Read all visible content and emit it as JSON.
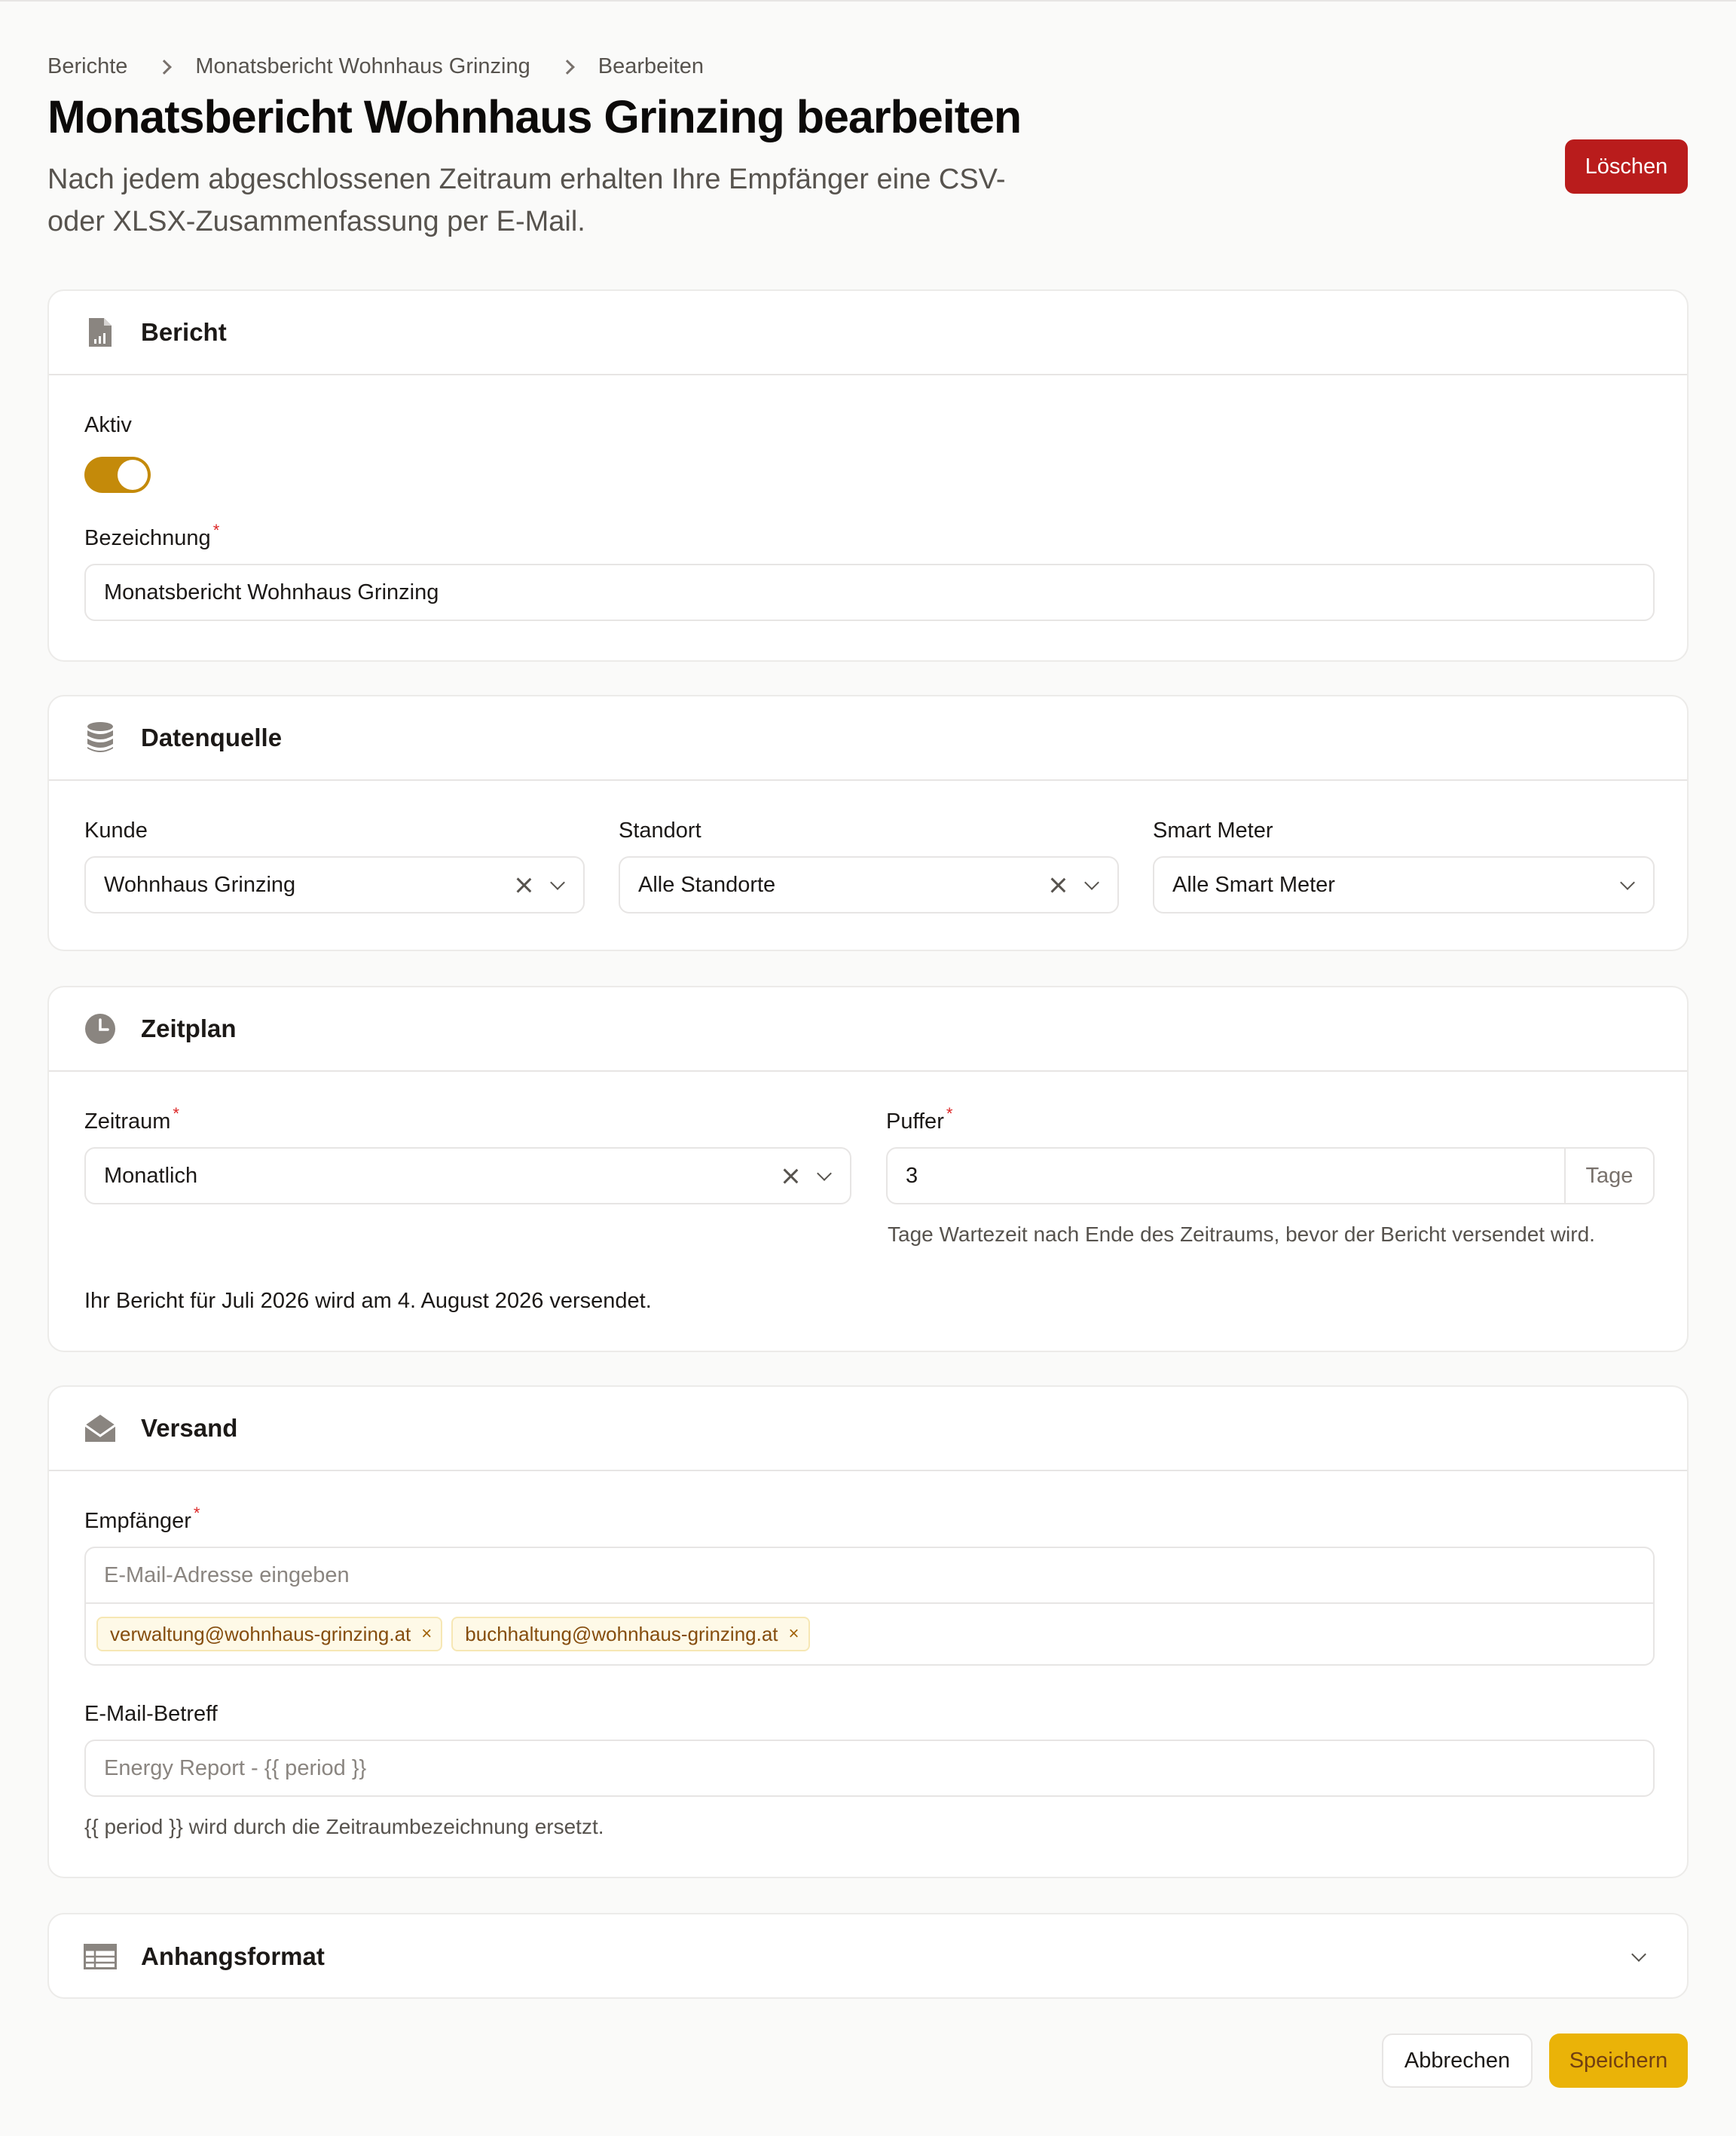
{
  "breadcrumb": [
    "Berichte",
    "Monatsbericht Wohnhaus Grinzing",
    "Bearbeiten"
  ],
  "page": {
    "title": "Monatsbericht Wohnhaus Grinzing bearbeiten",
    "subtitle": "Nach jedem abgeschlossenen Zeitraum erhalten Ihre Empfänger eine CSV- oder XLSX-Zusammenfassung per E-Mail.",
    "delete_label": "Löschen"
  },
  "bericht": {
    "title": "Bericht",
    "icon": "report-file-icon",
    "active_label": "Aktiv",
    "active": true,
    "name_label": "Bezeichnung",
    "name_value": "Monatsbericht Wohnhaus Grinzing"
  },
  "datenquelle": {
    "title": "Datenquelle",
    "icon": "database-icon",
    "kunde_label": "Kunde",
    "kunde_value": "Wohnhaus Grinzing",
    "standort_label": "Standort",
    "standort_value": "Alle Standorte",
    "meter_label": "Smart Meter",
    "meter_value": "Alle Smart Meter"
  },
  "zeitplan": {
    "title": "Zeitplan",
    "icon": "clock-icon",
    "zeitraum_label": "Zeitraum",
    "zeitraum_value": "Monatlich",
    "puffer_label": "Puffer",
    "puffer_value": "3",
    "puffer_unit": "Tage",
    "puffer_hint": "Tage Wartezeit nach Ende des Zeitraums, bevor der Bericht versendet wird.",
    "schedule_note": "Ihr Bericht für Juli 2026 wird am 4. August 2026 versendet."
  },
  "versand": {
    "title": "Versand",
    "icon": "mail-open-icon",
    "recipients_label": "Empfänger",
    "recipients_placeholder": "E-Mail-Adresse eingeben",
    "recipients": [
      "verwaltung@wohnhaus-grinzing.at",
      "buchhaltung@wohnhaus-grinzing.at"
    ],
    "subject_label": "E-Mail-Betreff",
    "subject_placeholder": "Energy Report - {{ period }}",
    "subject_hint": "{{ period }} wird durch die Zeitraumbezeichnung ersetzt."
  },
  "anhangsformat": {
    "title": "Anhangsformat",
    "icon": "table-icon"
  },
  "footer": {
    "cancel_label": "Abbrechen",
    "save_label": "Speichern"
  },
  "colors": {
    "accent": "#eab308",
    "toggle_on": "#c48a0a",
    "danger": "#b91c1c",
    "required": "#dc2626"
  }
}
